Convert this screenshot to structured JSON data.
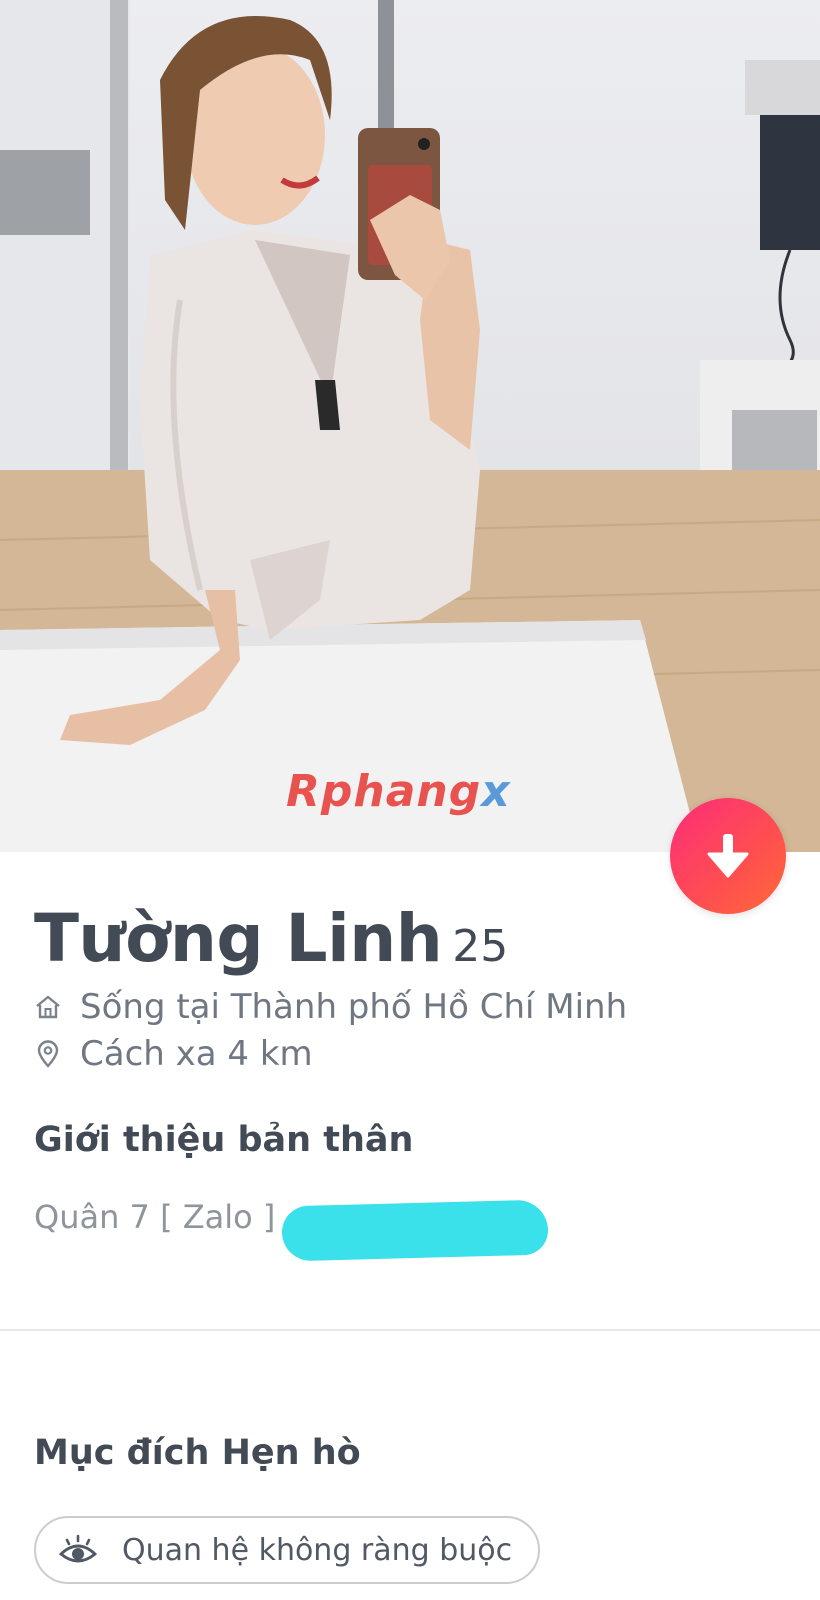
{
  "profile": {
    "name": "Tường Linh",
    "age": "25",
    "lives_in": "Sống tại Thành phố Hồ Chí Minh",
    "distance": "Cách xa 4 km"
  },
  "watermark": {
    "part1": "Rphang",
    "part2": "x"
  },
  "about": {
    "title": "Giới thiệu bản thân",
    "text": "Quân 7 [ Zalo ]"
  },
  "dating_goal": {
    "title": "Mục đích Hẹn hò",
    "chip_label": "Quan hệ không ràng buộc"
  },
  "icons": {
    "home": "home-icon",
    "location": "location-pin-icon",
    "eye": "eye-icon",
    "arrow": "arrow-down-icon"
  },
  "colors": {
    "accent_gradient_start": "#fd2c7a",
    "accent_gradient_end": "#ff6a3a",
    "redaction": "#3ae0ea"
  }
}
